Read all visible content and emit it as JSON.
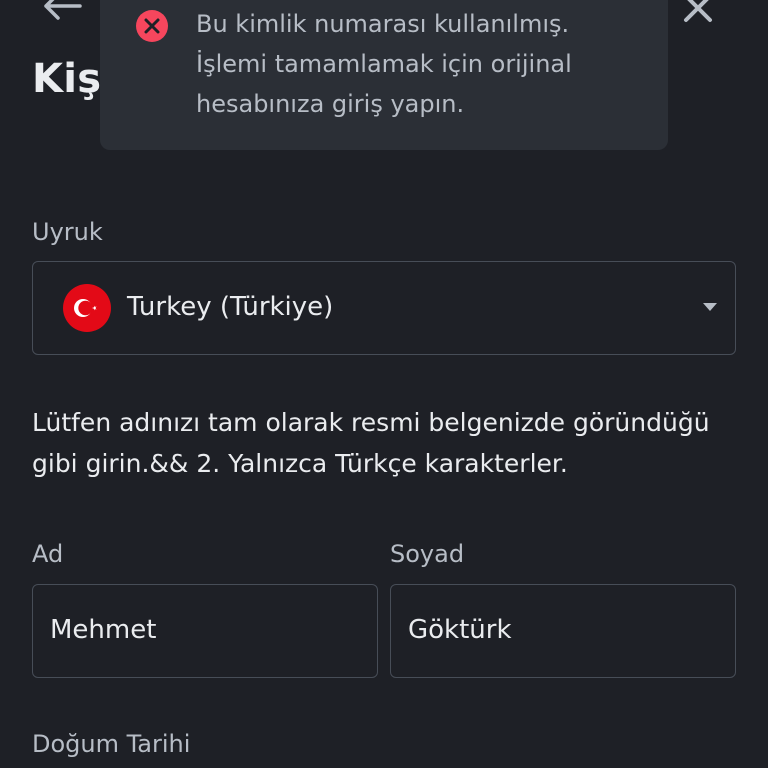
{
  "header": {
    "title_visible": "Kiş"
  },
  "toast": {
    "type": "error",
    "message": "Bu kimlik numarası kullanılmış. İşlemi tamamlamak için orijinal hesabınıza giriş yapın."
  },
  "form": {
    "nationality": {
      "label": "Uyruk",
      "value": "Turkey (Türkiye)",
      "flag_icon": "turkey-flag-icon"
    },
    "instruction": "Lütfen adınızı tam olarak resmi belgenizde göründüğü gibi girin.&& 2. Yalnızca Türkçe karakterler.",
    "first_name": {
      "label": "Ad",
      "value": "Mehmet"
    },
    "last_name": {
      "label": "Soyad",
      "value": "Göktürk"
    },
    "birth_date": {
      "label": "Doğum Tarihi"
    }
  },
  "colors": {
    "background": "#1e2026",
    "toast_background": "#2b2f36",
    "error": "#f6465d",
    "border": "#474d57",
    "text_primary": "#eaecef",
    "text_secondary": "#b7bdc6"
  }
}
